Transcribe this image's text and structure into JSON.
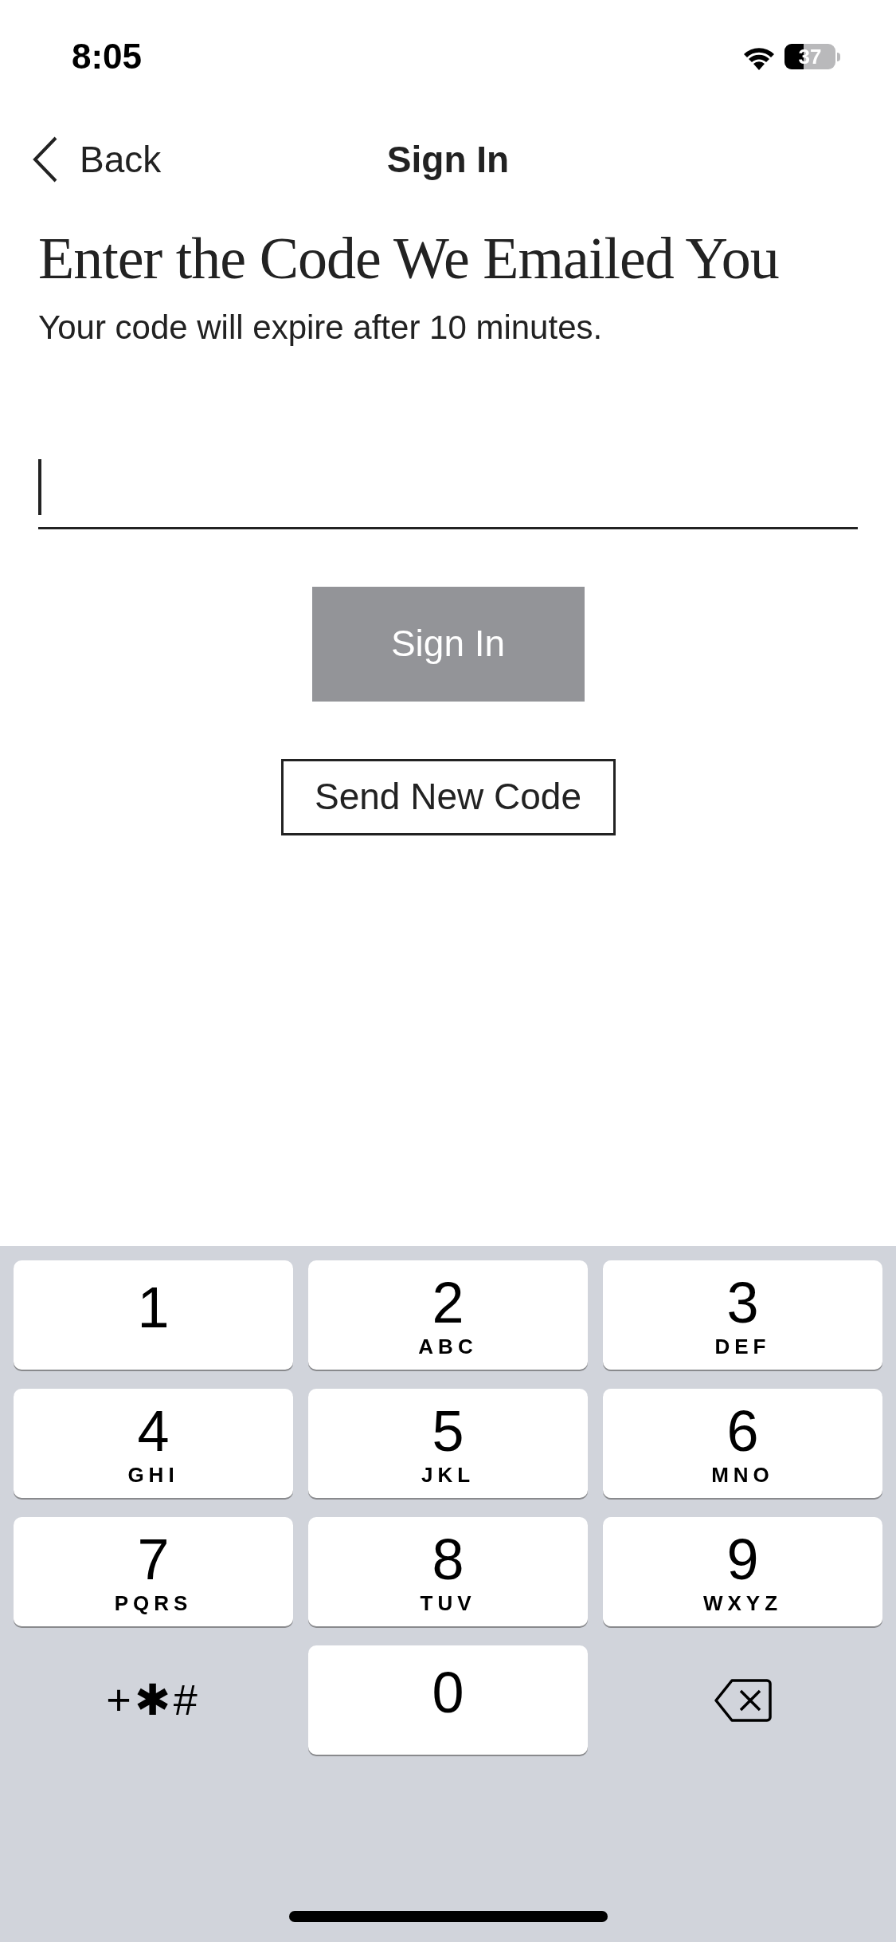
{
  "status_bar": {
    "time": "8:05",
    "battery": "37"
  },
  "nav": {
    "back_label": "Back",
    "title": "Sign In"
  },
  "heading": "Enter the Code We Emailed You",
  "subtitle": "Your code will expire after 10 minutes.",
  "code_field": {
    "focused": true
  },
  "sign_in_button": {
    "label": "Sign In",
    "disabled": true
  },
  "send_code_button": {
    "label": "Send New Code"
  },
  "keypad": [
    {
      "kind": "key",
      "digit": "1"
    },
    {
      "kind": "key",
      "digit": "2",
      "letters": "ABC"
    },
    {
      "kind": "key",
      "digit": "3",
      "letters": "DEF"
    },
    {
      "kind": "key",
      "digit": "4",
      "letters": "GHI"
    },
    {
      "kind": "key",
      "digit": "5",
      "letters": "JKL"
    },
    {
      "kind": "key",
      "digit": "6",
      "letters": "MNO"
    },
    {
      "kind": "key",
      "digit": "7",
      "letters": "PQRS"
    },
    {
      "kind": "key",
      "digit": "8",
      "letters": "TUV"
    },
    {
      "kind": "key",
      "digit": "9",
      "letters": "WXYZ"
    },
    {
      "kind": "symbols",
      "label": "+✱#"
    },
    {
      "kind": "key",
      "digit": "0"
    },
    {
      "kind": "delete"
    }
  ]
}
